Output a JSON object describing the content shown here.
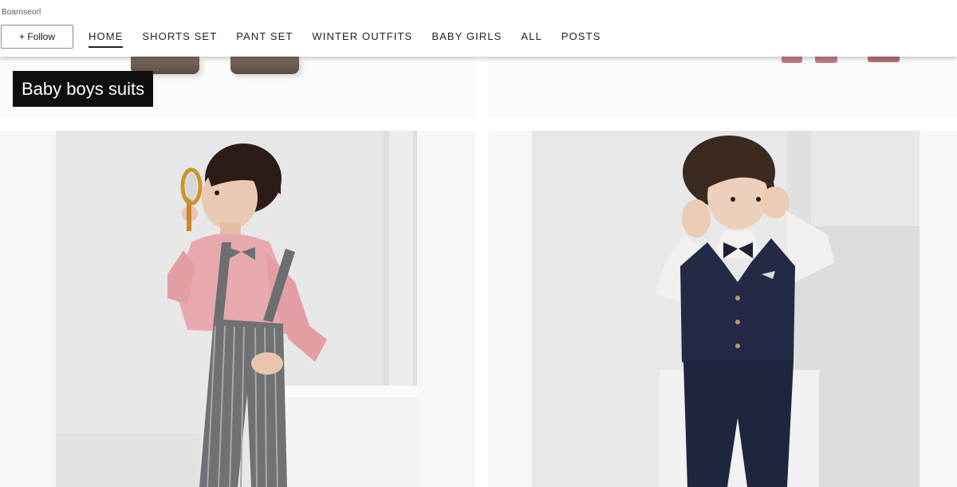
{
  "header": {
    "brand": "Boarnseorl",
    "follow_label": "+ Follow"
  },
  "nav": {
    "items": [
      {
        "label": "HOME",
        "active": true
      },
      {
        "label": "SHORTS SET",
        "active": false
      },
      {
        "label": "PANT SET",
        "active": false
      },
      {
        "label": "WINTER OUTFITS",
        "active": false
      },
      {
        "label": "BABY GIRLS",
        "active": false
      },
      {
        "label": "ALL",
        "active": false
      },
      {
        "label": "POSTS",
        "active": false
      }
    ]
  },
  "collection": {
    "label": "Baby boys suits"
  },
  "products": [
    {
      "image_desc": "boy-pink-shirt-grey-striped-overalls"
    },
    {
      "image_desc": "boy-navy-vest-suit-bow-tie"
    }
  ],
  "colors": {
    "header_bg": "#ffffff",
    "label_bg": "#0f0f0f",
    "label_text": "#ffffff",
    "tile_bg": "#f6f7f7",
    "nav_text": "#222222"
  }
}
